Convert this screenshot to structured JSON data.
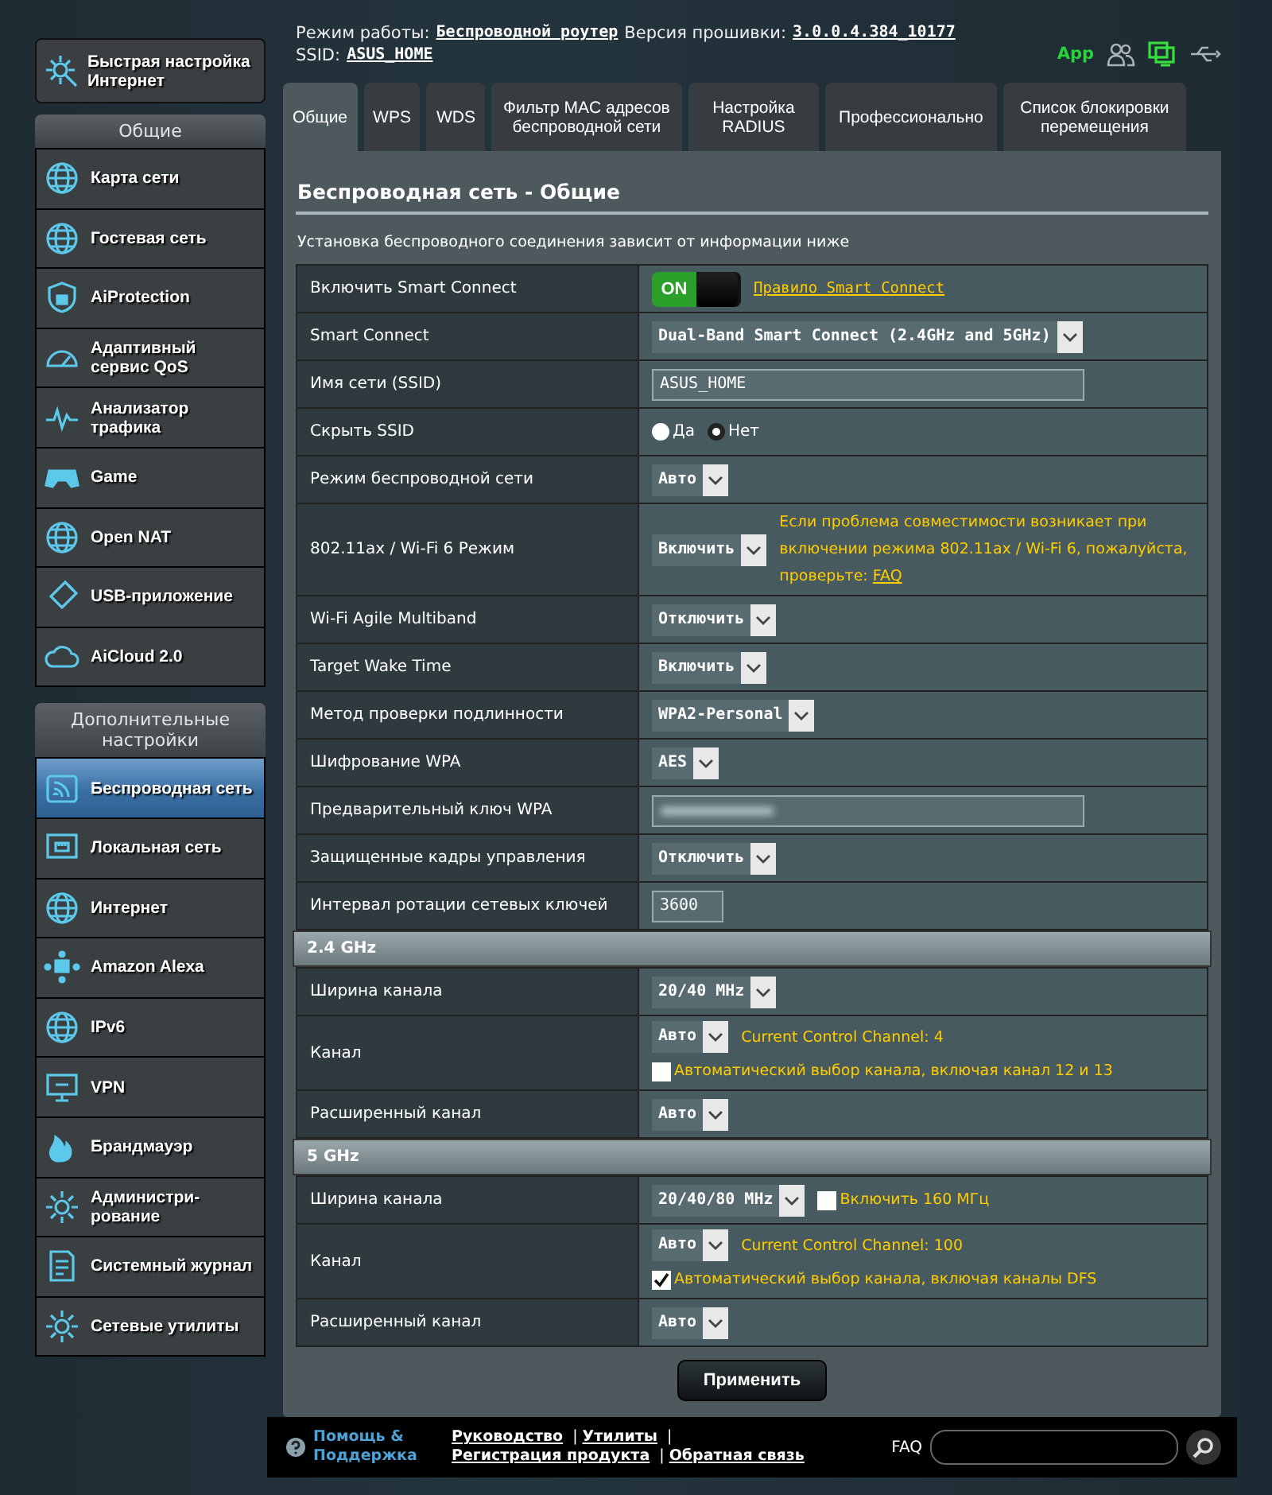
{
  "top": {
    "mode_label": "Режим работы:",
    "mode": "Беспроводной роутер",
    "firmware_label": "Версия прошивки:",
    "firmware": "3.0.0.4.384_10177",
    "ssid_label": "SSID:",
    "ssid": "ASUS_HOME",
    "app_label": "App"
  },
  "sidebar": {
    "quick_setup": "Быстрая настройка Интернет",
    "general_header": "Общие",
    "general_items": [
      {
        "label": "Карта сети",
        "selected": false
      },
      {
        "label": "Гостевая сеть",
        "selected": false
      },
      {
        "label": "AiProtection",
        "selected": false
      },
      {
        "label": "Адаптивный сервис QoS",
        "selected": false
      },
      {
        "label": "Анализатор трафика",
        "selected": false
      },
      {
        "label": "Game",
        "selected": false
      },
      {
        "label": "Open NAT",
        "selected": false
      },
      {
        "label": "USB-приложение",
        "selected": false
      },
      {
        "label": "AiCloud 2.0",
        "selected": false
      }
    ],
    "advanced_header": "Дополнительные настройки",
    "advanced_items": [
      {
        "label": "Беспроводная сеть",
        "selected": true
      },
      {
        "label": "Локальная сеть",
        "selected": false
      },
      {
        "label": "Интернет",
        "selected": false
      },
      {
        "label": "Amazon Alexa",
        "selected": false
      },
      {
        "label": "IPv6",
        "selected": false
      },
      {
        "label": "VPN",
        "selected": false
      },
      {
        "label": "Брандмауэр",
        "selected": false
      },
      {
        "label": "Администри-рование",
        "selected": false
      },
      {
        "label": "Системный журнал",
        "selected": false
      },
      {
        "label": "Сетевые утилиты",
        "selected": false
      }
    ]
  },
  "tabs": [
    {
      "label": "Общие",
      "selected": true
    },
    {
      "label": "WPS",
      "selected": false
    },
    {
      "label": "WDS",
      "selected": false
    },
    {
      "label": "Фильтр MAC адресов беспроводной сети",
      "selected": false
    },
    {
      "label": "Настройка RADIUS",
      "selected": false
    },
    {
      "label": "Профессионально",
      "selected": false
    },
    {
      "label": "Список блокировки перемещения",
      "selected": false
    }
  ],
  "page": {
    "title": "Беспроводная сеть - Общие",
    "description": "Установка беспроводного соединения зависит от информации ниже",
    "sections": [
      {
        "rows": [
          {
            "label": "Включить Smart Connect",
            "lines": [
              [
                {
                  "kind": "toggle",
                  "text": "ON",
                  "on": true
                },
                {
                  "kind": "link",
                  "text": "Правило Smart Connect"
                }
              ]
            ]
          },
          {
            "label": "Smart Connect",
            "lines": [
              [
                {
                  "kind": "select",
                  "text": "Dual-Band Smart Connect (2.4GHz and 5GHz)"
                }
              ]
            ]
          },
          {
            "label": "Имя сети (SSID)",
            "lines": [
              [
                {
                  "kind": "input",
                  "text": "ASUS_HOME"
                }
              ]
            ]
          },
          {
            "label": "Скрыть SSID",
            "lines": [
              [
                {
                  "kind": "radio",
                  "options": [
                    {
                      "text": "Да",
                      "selected": false
                    },
                    {
                      "text": "Нет",
                      "selected": true
                    }
                  ]
                }
              ]
            ]
          },
          {
            "label": "Режим беспроводной сети",
            "lines": [
              [
                {
                  "kind": "select",
                  "text": "Авто"
                }
              ]
            ]
          },
          {
            "label": "802.11ax / Wi-Fi 6 Режим",
            "lines": [
              [
                {
                  "kind": "select",
                  "text": "Включить"
                },
                {
                  "kind": "note",
                  "text": "Если проблема совместимости возникает при включении режима 802.11ax / Wi-Fi 6, пожалуйста, проверьте: ",
                  "link": "FAQ"
                }
              ]
            ]
          },
          {
            "label": "Wi-Fi Agile Multiband",
            "lines": [
              [
                {
                  "kind": "select",
                  "text": "Отключить"
                }
              ]
            ]
          },
          {
            "label": "Target Wake Time",
            "lines": [
              [
                {
                  "kind": "select",
                  "text": "Включить"
                }
              ]
            ]
          },
          {
            "label": "Метод проверки подлинности",
            "lines": [
              [
                {
                  "kind": "select",
                  "text": "WPA2-Personal"
                }
              ]
            ]
          },
          {
            "label": "Шифрование WPA",
            "lines": [
              [
                {
                  "kind": "select",
                  "text": "AES"
                }
              ]
            ]
          },
          {
            "label": "Предварительный ключ WPA",
            "lines": [
              [
                {
                  "kind": "hidden_input"
                }
              ]
            ]
          },
          {
            "label": "Защищенные кадры управления",
            "lines": [
              [
                {
                  "kind": "select",
                  "text": "Отключить"
                }
              ]
            ]
          },
          {
            "label": "Интервал ротации сетевых ключей",
            "lines": [
              [
                {
                  "kind": "short_input",
                  "text": "3600"
                }
              ]
            ]
          }
        ]
      },
      {
        "title": "2.4 GHz",
        "rows": [
          {
            "label": "Ширина канала",
            "lines": [
              [
                {
                  "kind": "select",
                  "text": "20/40 MHz"
                }
              ]
            ]
          },
          {
            "label": "Канал",
            "lines": [
              [
                {
                  "kind": "select",
                  "text": "Авто"
                },
                {
                  "kind": "note",
                  "text": "Current Control Channel: 4"
                }
              ],
              [
                {
                  "kind": "checkbox",
                  "checked": false,
                  "text": "Автоматический выбор канала, включая канал 12 и 13"
                }
              ]
            ]
          },
          {
            "label": "Расширенный канал",
            "lines": [
              [
                {
                  "kind": "select",
                  "text": "Авто"
                }
              ]
            ]
          }
        ]
      },
      {
        "title": "5 GHz",
        "rows": [
          {
            "label": "Ширина канала",
            "lines": [
              [
                {
                  "kind": "select",
                  "text": "20/40/80 MHz"
                },
                {
                  "kind": "checkbox",
                  "checked": false,
                  "text": "Включить 160 МГц"
                }
              ]
            ]
          },
          {
            "label": "Канал",
            "lines": [
              [
                {
                  "kind": "select",
                  "text": "Авто"
                },
                {
                  "kind": "note",
                  "text": "Current Control Channel: 100"
                }
              ],
              [
                {
                  "kind": "checkbox",
                  "checked": true,
                  "text": "Автоматический выбор канала, включая каналы DFS"
                }
              ]
            ]
          },
          {
            "label": "Расширенный канал",
            "lines": [
              [
                {
                  "kind": "select",
                  "text": "Авто"
                }
              ]
            ]
          }
        ]
      }
    ],
    "apply": "Применить"
  },
  "footer": {
    "help": "Помощь & Поддержка",
    "links": [
      "Руководство",
      "Утилиты",
      "Регистрация продукта",
      "Обратная связь"
    ],
    "separator": "|",
    "faq_label": "FAQ"
  }
}
